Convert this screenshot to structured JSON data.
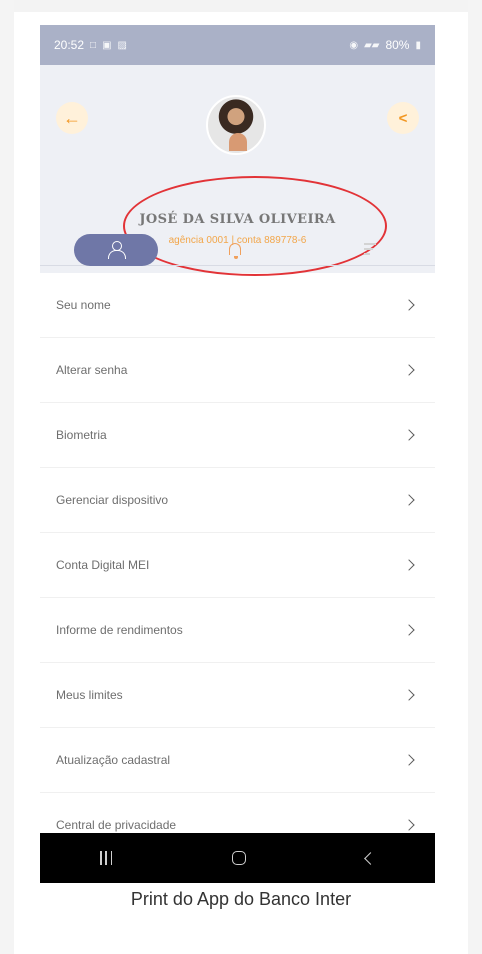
{
  "status_bar": {
    "time": "20:52",
    "left_icons": [
      "notification-icon",
      "lock-icon",
      "image-icon"
    ],
    "right_status": "80%"
  },
  "profile": {
    "name": "JOSÉ DA SILVA OLIVEIRA",
    "agency_label": "agência 0001",
    "account_label": "conta 889778-6"
  },
  "tabs": [
    {
      "name": "profile",
      "icon": "person-icon",
      "active": true
    },
    {
      "name": "notifications",
      "icon": "bell-icon",
      "active": false
    },
    {
      "name": "menu",
      "icon": "menu-icon",
      "active": false
    }
  ],
  "menu_items": [
    "Seu nome",
    "Alterar senha",
    "Biometria",
    "Gerenciar dispositivo",
    "Conta Digital MEI",
    "Informe de rendimentos",
    "Meus limites",
    "Atualização cadastral",
    "Central de privacidade"
  ],
  "caption": "Print do App do Banco Inter",
  "colors": {
    "accent": "#6f77a7",
    "orange": "#f29722",
    "highlight": "#e23337"
  }
}
